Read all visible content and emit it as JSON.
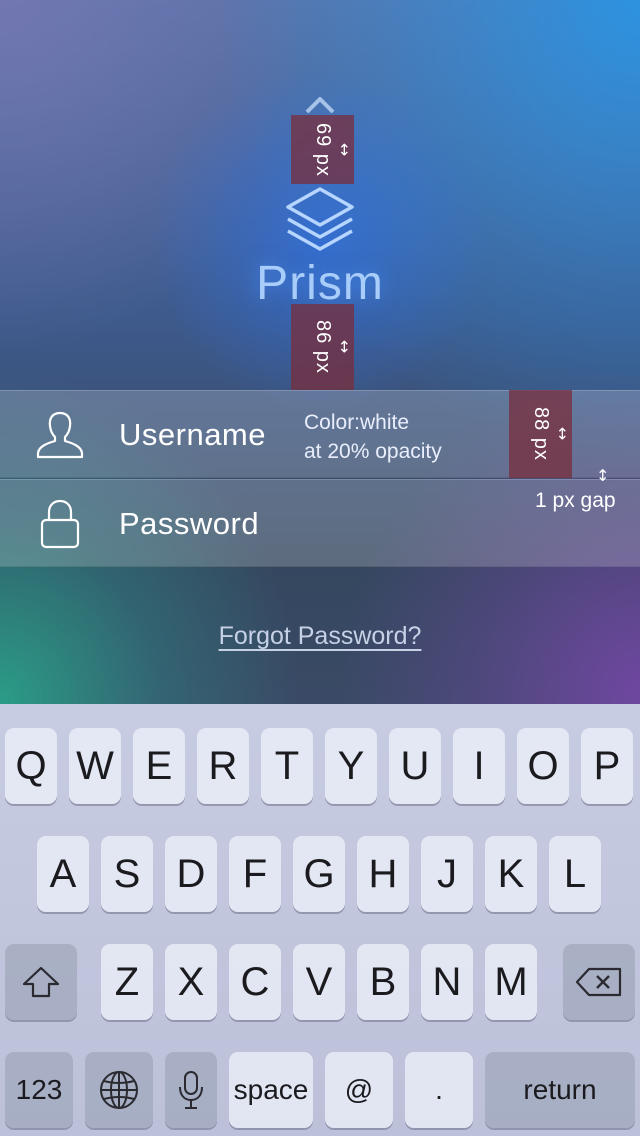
{
  "app": {
    "name": "Prism"
  },
  "measurements": {
    "top_spacing": "69 px",
    "logo_spacing": "86 px",
    "field_height": "88 px",
    "gap_label": "1 px gap",
    "arrow_glyph": "↕"
  },
  "annotation": {
    "line1": "Color:white",
    "line2": "at 20% opacity"
  },
  "login": {
    "username_label": "Username",
    "password_label": "Password",
    "forgot_password": "Forgot Password?"
  },
  "icons": {
    "chevron": "chevron-up-icon",
    "logo": "layers-stack-icon",
    "username": "user-icon",
    "password": "lock-icon",
    "shift": "shift-icon",
    "delete": "backspace-icon",
    "globe": "globe-icon",
    "mic": "microphone-icon"
  },
  "colors": {
    "brand_text": "#a9cdfa",
    "field_background": "rgba(255,255,255,0.2)",
    "measure_box": "#7a2d3c"
  },
  "keyboard": {
    "row1": [
      "Q",
      "W",
      "E",
      "R",
      "T",
      "Y",
      "U",
      "I",
      "O",
      "P"
    ],
    "row2": [
      "A",
      "S",
      "D",
      "F",
      "G",
      "H",
      "J",
      "K",
      "L"
    ],
    "row3": [
      "Z",
      "X",
      "C",
      "V",
      "B",
      "N",
      "M"
    ],
    "numbers": "123",
    "space": "space",
    "at": "@",
    "period": ".",
    "return": "return"
  }
}
